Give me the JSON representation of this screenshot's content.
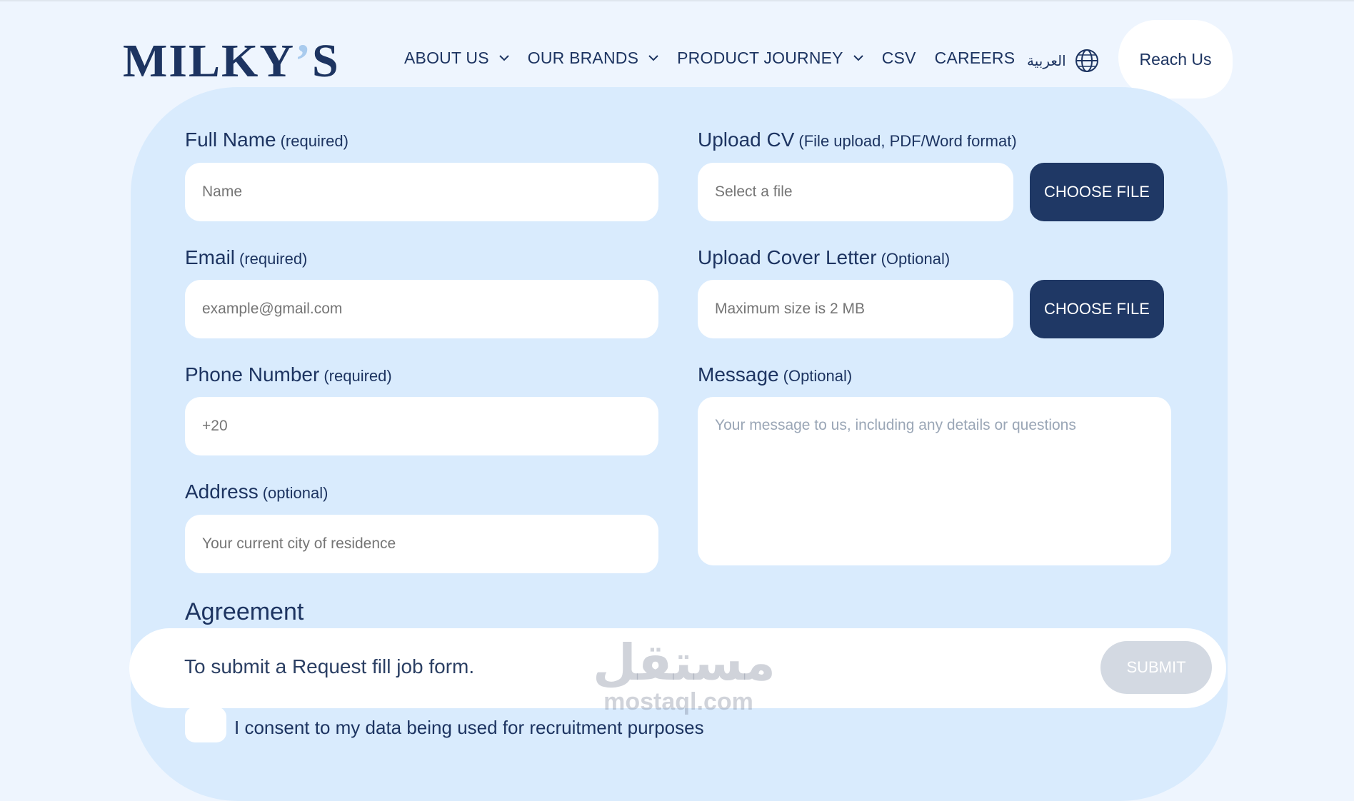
{
  "brand": {
    "logo": "MILKY",
    "logo_apos": "’",
    "logo_s": "S"
  },
  "nav": {
    "items": [
      {
        "label": "ABOUT US",
        "dropdown": true
      },
      {
        "label": "OUR BRANDS",
        "dropdown": true
      },
      {
        "label": "PRODUCT JOURNEY",
        "dropdown": true
      },
      {
        "label": "CSV",
        "dropdown": false
      },
      {
        "label": "CAREERS",
        "dropdown": false
      }
    ],
    "language": "العربية",
    "cta": "Reach Us"
  },
  "form": {
    "full_name": {
      "label": "Full Name",
      "note": "(required)",
      "placeholder": "Name"
    },
    "email": {
      "label": "Email",
      "note": "(required)",
      "placeholder": "example@gmail.com"
    },
    "phone": {
      "label": "Phone Number",
      "note": "(required)",
      "placeholder": "+20"
    },
    "address": {
      "label": "Address",
      "note": "(optional)",
      "placeholder": "Your current city of residence"
    },
    "cv": {
      "label": "Upload CV",
      "note": "(File upload, PDF/Word format)",
      "placeholder": "Select a file",
      "button": "CHOOSE FILE"
    },
    "cover_letter": {
      "label": "Upload Cover Letter",
      "note": "(Optional)",
      "placeholder": "Maximum size is 2 MB",
      "button": "CHOOSE FILE"
    },
    "message": {
      "label": "Message",
      "note": "(Optional)",
      "placeholder": "Your message to us, including any details or questions"
    },
    "agreement": {
      "heading": "Agreement",
      "submit_text": "To submit a Request fill job form.",
      "submit_button": "SUBMIT",
      "consent": "I consent to my data being used for recruitment purposes"
    }
  },
  "watermark": {
    "arabic": "مستقل",
    "latin": "mostaql.com"
  },
  "colors": {
    "primary": "#1f3865",
    "panel": "#d9ebfd",
    "background": "#eef5fe",
    "disabled": "#d3d9e2"
  }
}
